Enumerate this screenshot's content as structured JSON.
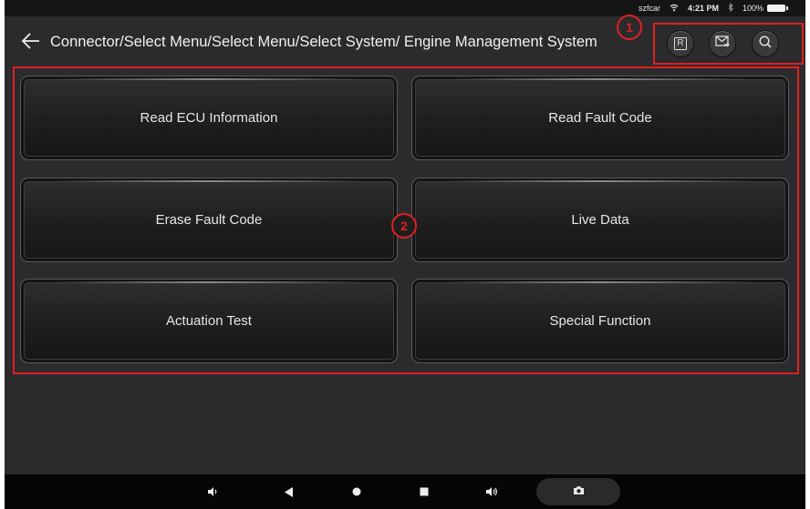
{
  "status_bar": {
    "carrier": "szfcar",
    "time": "4:21 PM",
    "battery": "100%",
    "icons": [
      "wifi-icon",
      "bluetooth-icon",
      "battery-icon"
    ]
  },
  "header": {
    "breadcrumb": "Connector/Select Menu/Select Menu/Select System/ Engine Management System",
    "back_icon": "back-arrow-icon",
    "marker_1": "1"
  },
  "toolbar": {
    "report_label": "R",
    "icons": [
      "report-icon",
      "mail-icon",
      "search-icon"
    ]
  },
  "grid": {
    "marker_2": "2",
    "buttons": [
      {
        "label": "Read ECU Information"
      },
      {
        "label": "Read Fault Code"
      },
      {
        "label": "Erase Fault Code"
      },
      {
        "label": "Live Data"
      },
      {
        "label": "Actuation Test"
      },
      {
        "label": "Special Function"
      }
    ]
  },
  "nav_bar": {
    "icons": [
      "volume-down-icon",
      "back-triangle-icon",
      "home-circle-icon",
      "recents-square-icon",
      "volume-up-icon",
      "camera-icon"
    ]
  },
  "colors": {
    "annotation": "#e02020",
    "background": "#2b2b2d",
    "button_text": "#e6e6e6"
  }
}
